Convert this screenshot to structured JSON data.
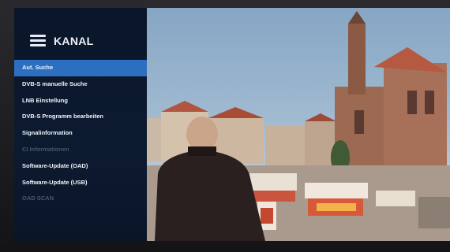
{
  "menu": {
    "title": "KANAL",
    "items": [
      {
        "label": "Aut. Suche",
        "state": "selected"
      },
      {
        "label": "DVB-S manuelle Suche",
        "state": "normal"
      },
      {
        "label": "LNB Einstellung",
        "state": "normal"
      },
      {
        "label": "DVB-S Programm bearbeiten",
        "state": "normal"
      },
      {
        "label": "Signalinformation",
        "state": "normal"
      },
      {
        "label": "CI Informationen",
        "state": "disabled"
      },
      {
        "label": "Software-Update (OAD)",
        "state": "normal"
      },
      {
        "label": "Software-Update (USB)",
        "state": "normal"
      },
      {
        "label": "OAD SCAN",
        "state": "disabled"
      }
    ]
  },
  "colors": {
    "highlight": "#2c6fc0",
    "panel": "#0a1629",
    "disabled_text": "#48566b"
  },
  "icons": [
    "menu-list-icon"
  ]
}
